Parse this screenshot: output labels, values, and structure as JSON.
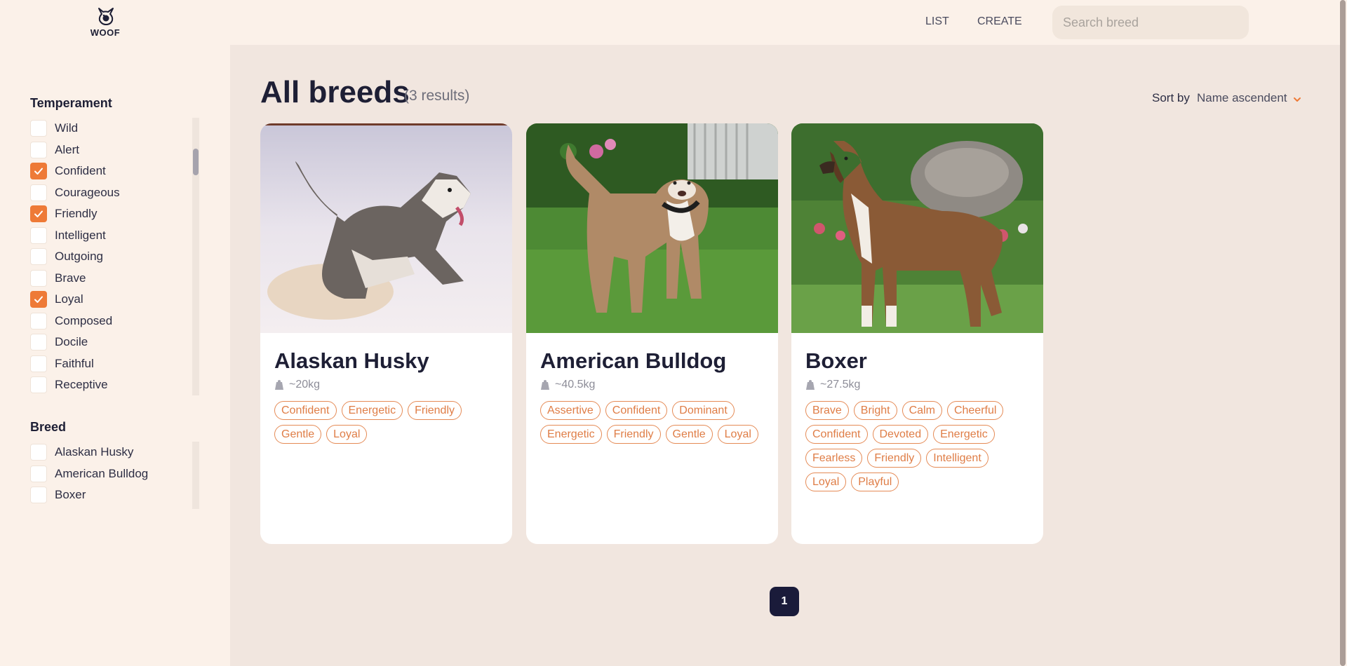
{
  "brand": {
    "name": "WOOF"
  },
  "nav": {
    "list_label": "LIST",
    "create_label": "CREATE"
  },
  "search": {
    "placeholder": "Search breed",
    "value": ""
  },
  "filters": {
    "temperament": {
      "title": "Temperament",
      "options": [
        {
          "label": "Wild",
          "checked": false
        },
        {
          "label": "Alert",
          "checked": false
        },
        {
          "label": "Confident",
          "checked": true
        },
        {
          "label": "Courageous",
          "checked": false
        },
        {
          "label": "Friendly",
          "checked": true
        },
        {
          "label": "Intelligent",
          "checked": false
        },
        {
          "label": "Outgoing",
          "checked": false
        },
        {
          "label": "Brave",
          "checked": false
        },
        {
          "label": "Loyal",
          "checked": true
        },
        {
          "label": "Composed",
          "checked": false
        },
        {
          "label": "Docile",
          "checked": false
        },
        {
          "label": "Faithful",
          "checked": false
        },
        {
          "label": "Receptive",
          "checked": false
        }
      ]
    },
    "breed": {
      "title": "Breed",
      "options": [
        {
          "label": "Alaskan Husky",
          "checked": false
        },
        {
          "label": "American Bulldog",
          "checked": false
        },
        {
          "label": "Boxer",
          "checked": false
        }
      ]
    }
  },
  "main": {
    "title": "All breeds",
    "results": "(3 results)",
    "sort_label": "Sort by",
    "sort_value": "Name ascendent"
  },
  "cards": [
    {
      "name": "Alaskan Husky",
      "weight": "~20kg",
      "tags": [
        "Confident",
        "Energetic",
        "Friendly",
        "Gentle",
        "Loyal"
      ]
    },
    {
      "name": "American Bulldog",
      "weight": "~40.5kg",
      "tags": [
        "Assertive",
        "Confident",
        "Dominant",
        "Energetic",
        "Friendly",
        "Gentle",
        "Loyal"
      ]
    },
    {
      "name": "Boxer",
      "weight": "~27.5kg",
      "tags": [
        "Brave",
        "Bright",
        "Calm",
        "Cheerful",
        "Confident",
        "Devoted",
        "Energetic",
        "Fearless",
        "Friendly",
        "Intelligent",
        "Loyal",
        "Playful"
      ]
    }
  ],
  "pagination": {
    "current": "1"
  },
  "colors": {
    "accent": "#ee7a37",
    "dark": "#1a1b3a",
    "background": "#fbf1e9",
    "main_bg": "#f1e6df"
  }
}
